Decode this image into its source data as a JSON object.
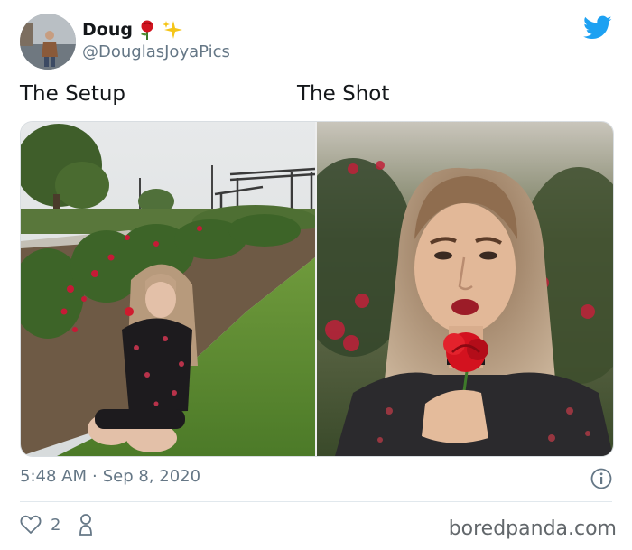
{
  "tweet": {
    "author_name": "Doug",
    "handle": "@DouglasJoyaPics",
    "caption_left": "The Setup",
    "caption_right": "The Shot",
    "time": "5:48 AM",
    "separator": "·",
    "date": "Sep 8, 2020",
    "like_count": "2"
  },
  "icons": {
    "name_emojis": [
      "rose-icon",
      "sparkles-icon"
    ],
    "brand": "twitter-bird-icon",
    "info": "info-icon",
    "like": "heart-icon",
    "user": "person-icon"
  },
  "colors": {
    "twitter_blue": "#1da1f2",
    "secondary_text": "#657786",
    "rose_red": "#d1141f"
  },
  "watermark": "boredpanda.com"
}
